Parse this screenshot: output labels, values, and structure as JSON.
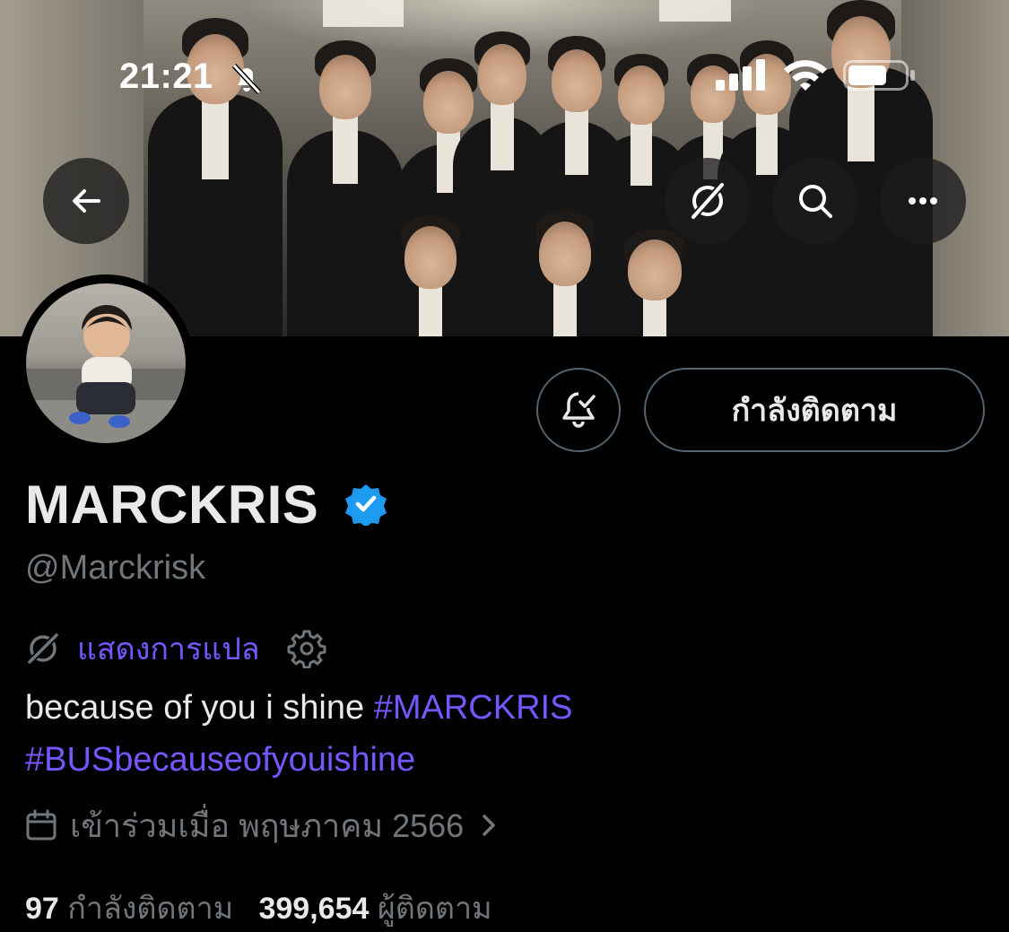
{
  "status_bar": {
    "time": "21:21"
  },
  "profile": {
    "display_name": "MARCKRIS",
    "handle": "@Marckrisk",
    "verified": true,
    "following_button_label": "กำลังติดตาม"
  },
  "translate": {
    "label": "แสดงการแปล"
  },
  "bio": {
    "text": "because of you i shine ",
    "hashtag_1": "#MARCKRIS",
    "hashtag_2": "#BUSbecauseofyouishine"
  },
  "joined": {
    "label": "เข้าร่วมเมื่อ พฤษภาคม 2566"
  },
  "stats": {
    "following_count": "97",
    "following_label": "กำลังติดตาม",
    "followers_count": "399,654",
    "followers_label": "ผู้ติดตาม"
  },
  "icons": {
    "back": "arrow-left-icon",
    "translate": "globe-slash-icon",
    "search": "search-icon",
    "more": "more-horizontal-icon",
    "notifications": "bell-check-icon",
    "settings": "gear-icon",
    "calendar": "calendar-icon",
    "verified": "verified-badge-icon"
  },
  "colors": {
    "background": "#000000",
    "text_primary": "#e7e9ea",
    "text_secondary": "#71767b",
    "accent": "#7856ff",
    "verified_blue": "#1d9bf0",
    "button_border": "#536471"
  }
}
